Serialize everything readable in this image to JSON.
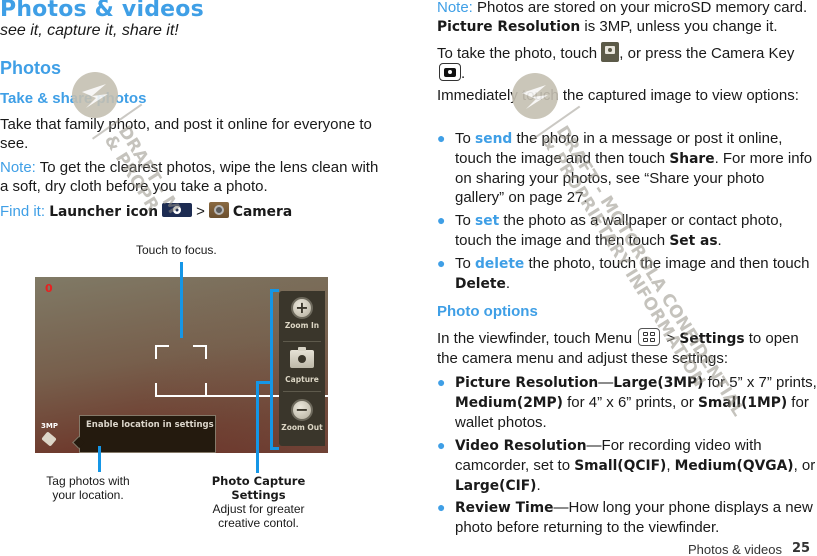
{
  "left": {
    "title": "Photos & videos",
    "subtitle": "see it, capture it, share it!",
    "section_heading": "Photos",
    "subsection_heading": "Take & share photos",
    "intro": "Take that family photo, and post it online for everyone to see.",
    "note_label": "Note:",
    "note_text": " To get the clearest photos, wipe the lens clean with a soft, dry cloth before you take a photo.",
    "findit_label": "Find it:",
    "findit_launcher": "Launcher icon",
    "findit_sep": ">",
    "findit_camera": "Camera",
    "findit_icons": [
      "launcher-icon",
      "camera-app-icon"
    ]
  },
  "camera_screen": {
    "rec_indicator": "0",
    "resolution_label": "3MP",
    "location_tooltip": "Enable location in settings",
    "controls": [
      {
        "label": "Zoom In",
        "icon": "zoom-in-icon",
        "glyph": "+"
      },
      {
        "label": "Capture",
        "icon": "capture-icon"
      },
      {
        "label": "Zoom Out",
        "icon": "zoom-out-icon",
        "glyph": "−"
      }
    ],
    "callouts": {
      "focus": "Touch to focus.",
      "tag": "Tag photos with your location.",
      "settings_title": "Photo Capture Settings",
      "settings_text": "Adjust for greater creative contol."
    }
  },
  "right": {
    "note_label": "Note:",
    "note_text_1": " Photos are stored on your microSD memory card. ",
    "note_bold": "Picture Resolution",
    "note_text_2": " is 3MP, unless you change it.",
    "take_text_1": "To take the photo, touch ",
    "take_text_2": ", or press the Camera Key ",
    "take_text_3": ".",
    "immediately": "Immediately touch the captured image to view options:",
    "options": [
      {
        "pre": "To ",
        "action": "send",
        "mid": " the photo in a message or post it online, touch the image and then touch ",
        "bold": "Share",
        "post": ". For more info on sharing your photos, see “Share your photo gallery” on page 27."
      },
      {
        "pre": "To ",
        "action": "set",
        "mid": " the photo as a wallpaper or contact photo, touch the image and then touch ",
        "bold": "Set as",
        "post": "."
      },
      {
        "pre": "To ",
        "action": "delete",
        "mid": " the photo, touch the image and then touch ",
        "bold": "Delete",
        "post": "."
      }
    ],
    "photo_options_heading": "Photo options",
    "viewfinder_text_1": "In the viewfinder, touch Menu ",
    "viewfinder_sep": " > ",
    "viewfinder_bold": "Settings",
    "viewfinder_text_2": " to open the camera menu and adjust these settings:",
    "settings": [
      {
        "name": "Picture Resolution",
        "dash": "—",
        "parts": [
          {
            "b": "Large(3MP)"
          },
          {
            "t": " for 5” x 7” prints, "
          },
          {
            "b": "Medium(2MP)"
          },
          {
            "t": " for 4” x 6” prints, or "
          },
          {
            "b": "Small(1MP)"
          },
          {
            "t": " for wallet photos."
          }
        ]
      },
      {
        "name": "Video Resolution",
        "dash": "—",
        "parts": [
          {
            "t": "For recording video with camcorder, set to "
          },
          {
            "b": "Small(QCIF)"
          },
          {
            "t": ", "
          },
          {
            "b": "Medium(QVGA)"
          },
          {
            "t": ", or "
          },
          {
            "b": "Large(CIF)"
          },
          {
            "t": "."
          }
        ]
      },
      {
        "name": "Review Time",
        "dash": "—",
        "parts": [
          {
            "t": "How long your phone displays a new photo before returning to the viewfinder."
          }
        ]
      }
    ]
  },
  "footer": {
    "section": "Photos & videos",
    "page_number": "25"
  },
  "watermark": {
    "left_line_1": "DRAFT - M",
    "left_line_2": "& PROPR",
    "right_line_1": "DRAFT - MOTOROLA CONFIDENTIAL",
    "right_line_2": "& PROPRIETARY INFORMATION"
  },
  "colors": {
    "accent_blue": "#3f9fe6",
    "callout_line": "#1596e6",
    "body_text": "#1a1a1a"
  }
}
